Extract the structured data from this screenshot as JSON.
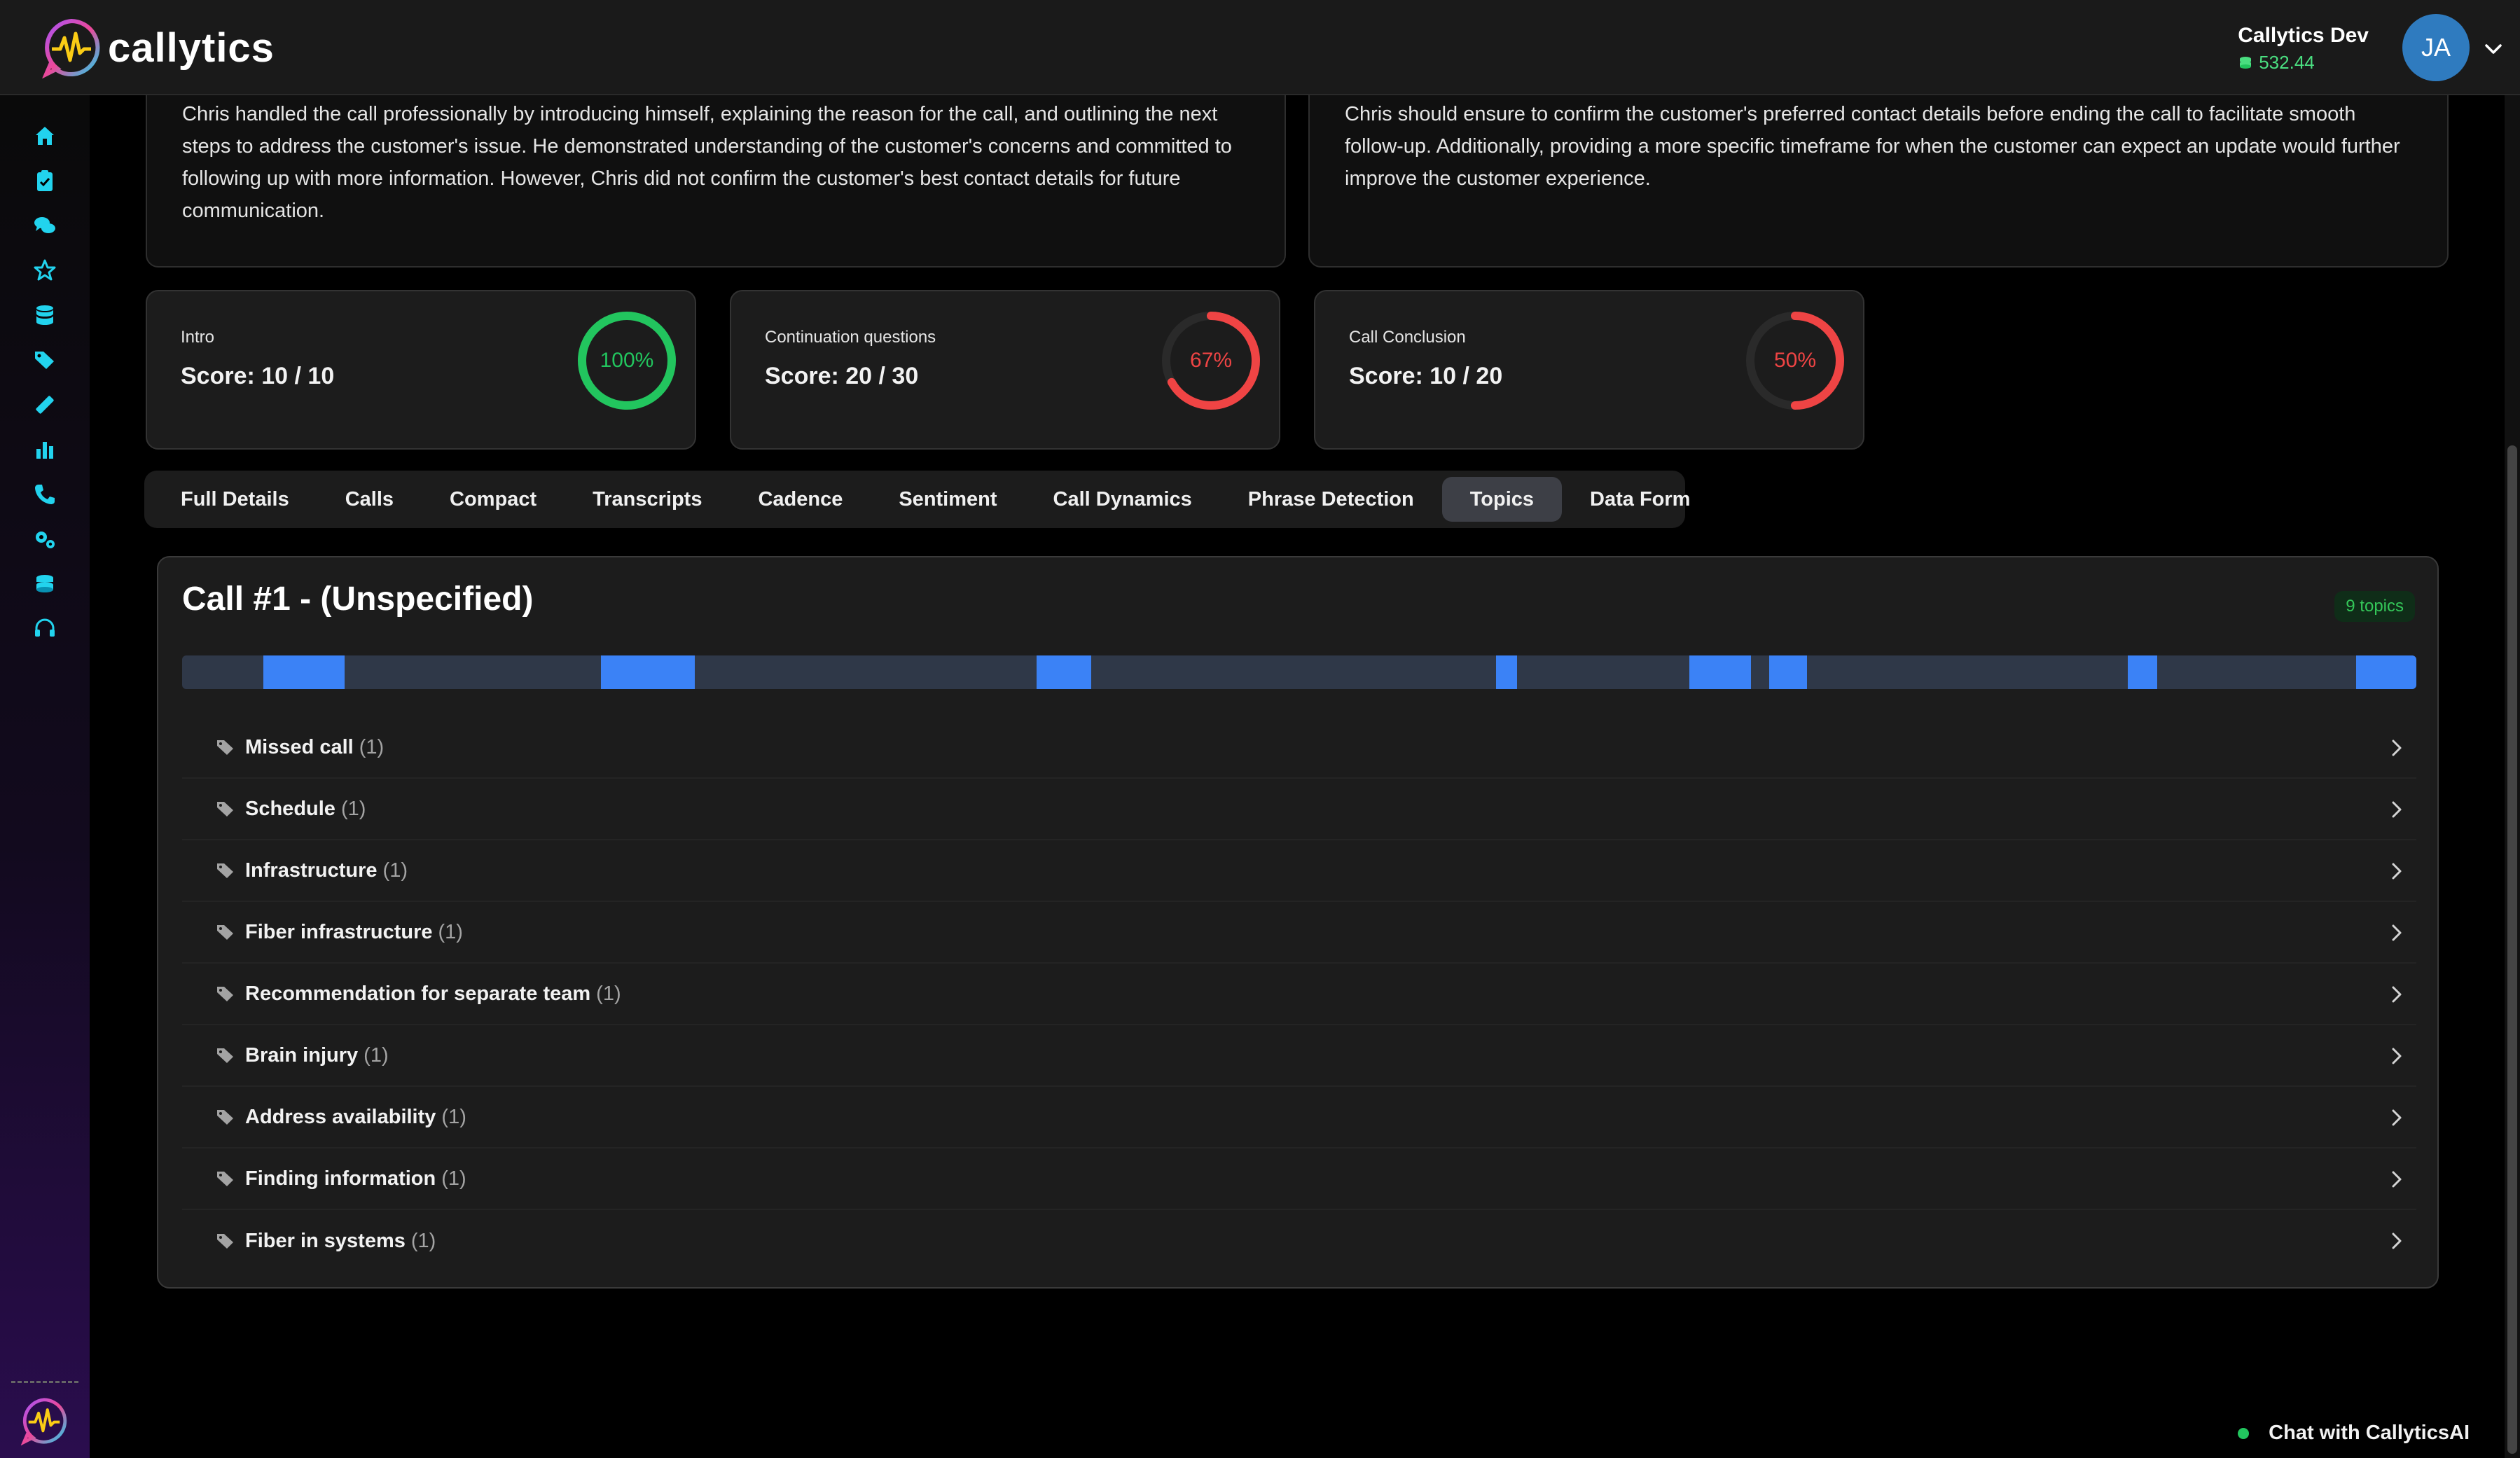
{
  "app": {
    "logo_text": "callytics"
  },
  "user": {
    "name": "Callytics Dev",
    "balance": "532.44",
    "initials": "JA"
  },
  "sidebar": {
    "icons": [
      "home-icon",
      "clipboard-check-icon",
      "chat-bubbles-icon",
      "star-icon",
      "database-icon",
      "tags-icon",
      "ruler-icon",
      "bar-chart-icon",
      "phone-icon",
      "gears-icon",
      "coins-icon",
      "headset-icon"
    ]
  },
  "summary": {
    "left_text": "Chris handled the call professionally by introducing himself, explaining the reason for the call, and outlining the next steps to address the customer's issue. He demonstrated understanding of the customer's concerns and committed to following up with more information. However, Chris did not confirm the customer's best contact details for future communication.",
    "right_text": "Chris should ensure to confirm the customer's preferred contact details before ending the call to facilitate smooth follow-up. Additionally, providing a more specific timeframe for when the customer can expect an update would further improve the customer experience."
  },
  "scores": [
    {
      "label": "Intro",
      "score": "Score: 10 / 10",
      "percent_text": "100%",
      "fraction": 1.0,
      "color": "#22c55e"
    },
    {
      "label": "Continuation questions",
      "score": "Score: 20 / 30",
      "percent_text": "67%",
      "fraction": 0.67,
      "color": "#ef4444"
    },
    {
      "label": "Call Conclusion",
      "score": "Score: 10 / 20",
      "percent_text": "50%",
      "fraction": 0.5,
      "color": "#ef4444"
    }
  ],
  "tabs": [
    "Full Details",
    "Calls",
    "Compact",
    "Transcripts",
    "Cadence",
    "Sentiment",
    "Call Dynamics",
    "Phrase Detection",
    "Topics",
    "Data Form"
  ],
  "active_tab": "Topics",
  "panel": {
    "title": "Call #1 - (Unspecified)",
    "badge": "9 topics",
    "topics": [
      {
        "name": "Missed call",
        "count": "(1)"
      },
      {
        "name": "Schedule",
        "count": "(1)"
      },
      {
        "name": "Infrastructure",
        "count": "(1)"
      },
      {
        "name": "Fiber infrastructure",
        "count": "(1)"
      },
      {
        "name": "Recommendation for separate team",
        "count": "(1)"
      },
      {
        "name": "Brain injury",
        "count": "(1)"
      },
      {
        "name": "Address availability",
        "count": "(1)"
      },
      {
        "name": "Finding information",
        "count": "(1)"
      },
      {
        "name": "Fiber in systems",
        "count": "(1)"
      }
    ]
  },
  "chat": {
    "label": "Chat with CallyticsAI"
  },
  "colors": {
    "accent": "#3b82f6",
    "success": "#22c55e",
    "danger": "#ef4444",
    "sidebar_icon": "#22d3ee"
  }
}
